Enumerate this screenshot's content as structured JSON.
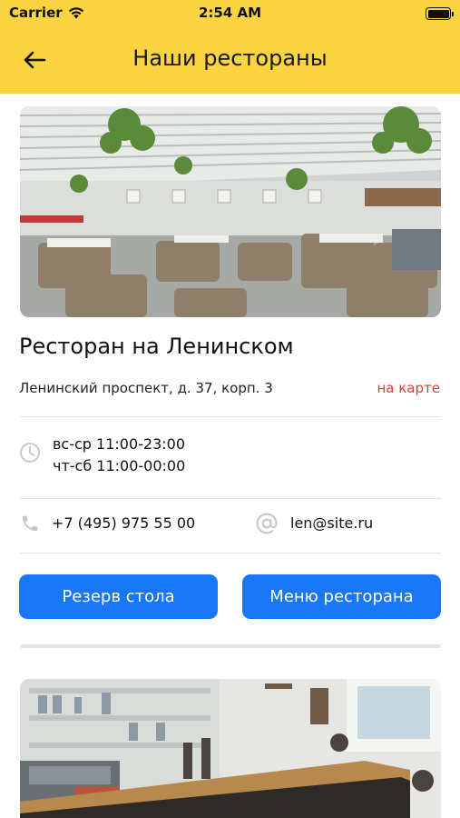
{
  "status_bar": {
    "carrier": "Carrier",
    "time": "2:54 AM"
  },
  "header": {
    "title": "Наши рестораны"
  },
  "restaurant": {
    "name": "Ресторан на Ленинском",
    "address": "Ленинский проспект, д. 37, корп. 3",
    "map_link": "на карте",
    "hours": [
      "вс-ср 11:00-23:00",
      "чт-сб 11:00-00:00"
    ],
    "phone": "+7 (495) 975 55 00",
    "email": "len@site.ru",
    "reserve_button": "Резерв стола",
    "menu_button": "Меню ресторана"
  },
  "colors": {
    "header_bg": "#fcd340",
    "button_bg": "#1976f5",
    "map_link": "#e53935",
    "divider": "#e4e4e4"
  },
  "icons": [
    "wifi-icon",
    "battery-icon",
    "back-arrow-icon",
    "clock-icon",
    "phone-icon",
    "at-sign-icon"
  ]
}
